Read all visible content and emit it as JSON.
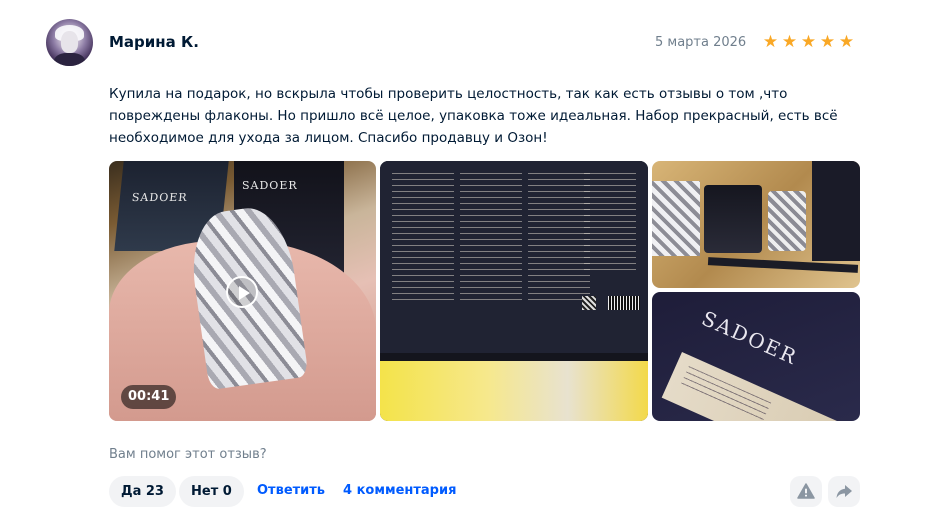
{
  "review": {
    "author": "Марина К.",
    "date": "5 марта 2026",
    "rating": 5,
    "stars": [
      "★",
      "★",
      "★",
      "★",
      "★"
    ],
    "star_color": "#f9a826",
    "text": "Купила на подарок, но вскрыла чтобы проверить целостность, так как есть отзывы о том ,что повреждены флаконы. Но пришло всё целое, упаковка тоже идеальная. Набор прекрасный, есть всё необходимое для ухода за лицом. Спасибо продавцу и Озон!"
  },
  "media": {
    "video": {
      "duration": "00:41",
      "brand_text": "SADOER"
    },
    "photo_logo": "SADOER"
  },
  "feedback": {
    "question": "Вам помог этот отзыв?",
    "yes_label": "Да 23",
    "no_label": "Нет 0",
    "reply_label": "Ответить",
    "comments_label": "4 комментария",
    "link_color": "#005bff"
  },
  "actions": {
    "report_icon": "warning-icon",
    "share_icon": "share-icon"
  }
}
